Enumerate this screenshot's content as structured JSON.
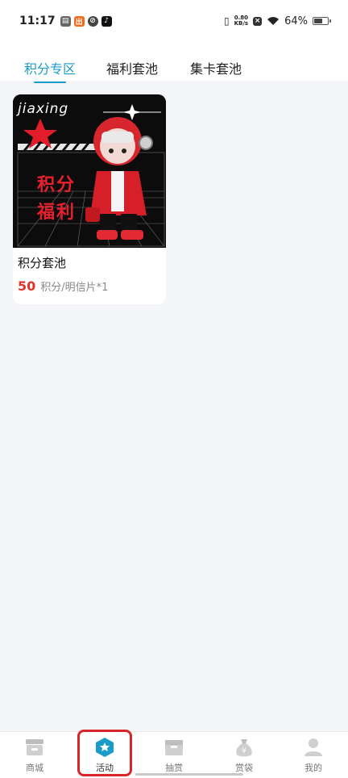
{
  "status_bar": {
    "time": "11:17",
    "net_speed_value": "0.80",
    "net_speed_unit": "KB/s",
    "battery_percent": "64%",
    "battery_level": 0.64
  },
  "tabs": [
    {
      "label": "积分专区",
      "active": true
    },
    {
      "label": "福利套池",
      "active": false
    },
    {
      "label": "集卡套池",
      "active": false
    }
  ],
  "card": {
    "image_brand_text": "jiaxing",
    "image_overlay_line1": "积分",
    "image_overlay_line2": "福利",
    "title": "积分套池",
    "price": "50",
    "price_unit": "积分/明信片*1"
  },
  "bottom_nav": [
    {
      "label": "商城",
      "icon": "shop-icon",
      "active": false
    },
    {
      "label": "活动",
      "icon": "activity-star-icon",
      "active": true
    },
    {
      "label": "抽赏",
      "icon": "box-icon",
      "active": false
    },
    {
      "label": "赏袋",
      "icon": "money-bag-icon",
      "active": false
    },
    {
      "label": "我的",
      "icon": "profile-icon",
      "active": false
    }
  ],
  "colors": {
    "accent": "#1a9cc8",
    "price": "#e3332b",
    "highlight": "#d9262b"
  }
}
